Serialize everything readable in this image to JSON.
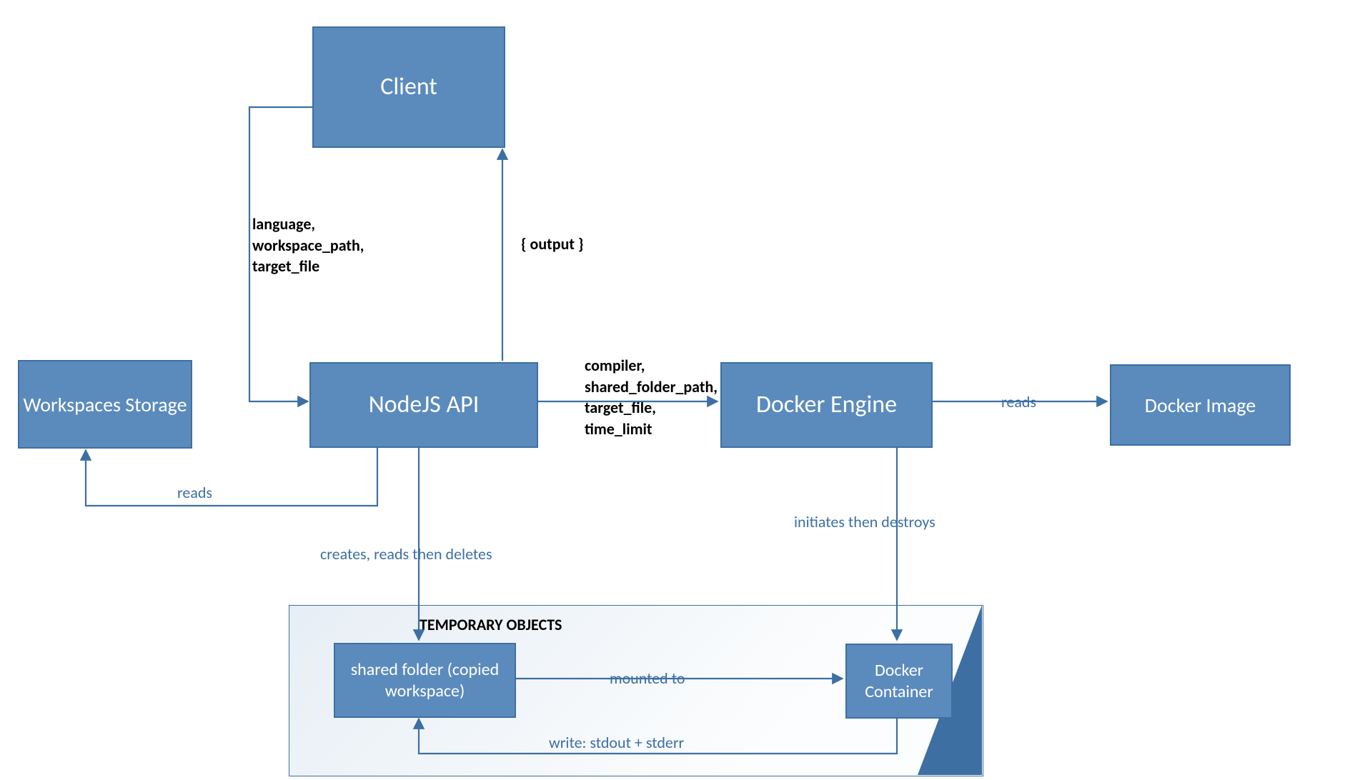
{
  "nodes": {
    "client": "Client",
    "workspaces_storage": "Workspaces\nStorage",
    "nodejs_api": "NodeJS API",
    "docker_engine": "Docker Engine",
    "docker_image": "Docker Image",
    "shared_folder": "shared folder\n(copied workspace)",
    "docker_container": "Docker\nContainer",
    "temporary_objects_title": "TEMPORARY OBJECTS"
  },
  "edges": {
    "client_to_api": "language,\nworkspace_path,\ntarget_file",
    "api_to_client": "{ output }",
    "api_to_engine": "compiler,\nshared_folder_path,\ntarget_file,\ntime_limit",
    "engine_to_image": "reads",
    "api_to_storage": "reads",
    "api_to_shared": "creates, reads then deletes",
    "engine_to_container": "initiates then destroys",
    "shared_to_container": "mounted to",
    "container_to_shared": "write: stdout + stderr"
  },
  "colors": {
    "node_fill": "#5b8bbd",
    "node_border": "#3d6fa3",
    "edge": "#3d6fa3",
    "edge_label_black": "#000000",
    "edge_label_blue": "#3d6fa3"
  }
}
